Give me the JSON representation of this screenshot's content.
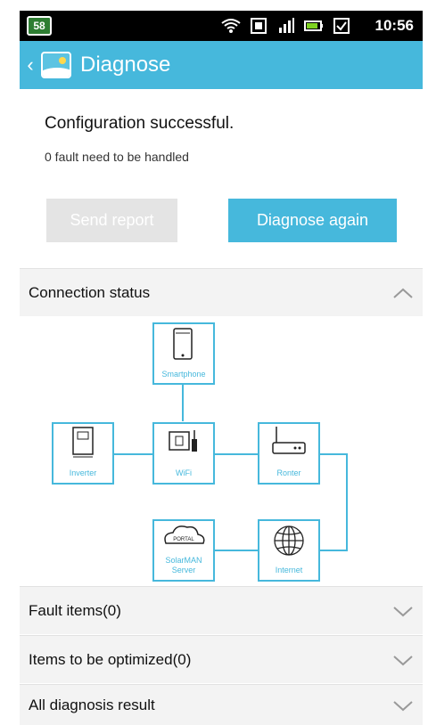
{
  "statusbar": {
    "left_badge": "58",
    "icons": [
      "wifi-icon",
      "data-icon",
      "signal-icon",
      "battery-icon",
      "checkbox-icon"
    ],
    "time": "10:56"
  },
  "appbar": {
    "title": "Diagnose"
  },
  "result": {
    "title": "Configuration successful.",
    "subtitle": "0 fault need to be handled"
  },
  "actions": {
    "send_report": "Send report",
    "diagnose_again": "Diagnose again"
  },
  "sections": {
    "connection_status": "Connection status",
    "fault_items": "Fault items(0)",
    "items_optimized": "Items to be optimized(0)",
    "all_result": "All diagnosis result"
  },
  "diagram": {
    "smartphone": "Smartphone",
    "inverter": "Inverter",
    "wifi": "WiFi",
    "router": "Ronter",
    "server_portal": "PORTAL",
    "server_line1": "SolarMAN",
    "server_line2": "Server",
    "internet": "Internet",
    "accent": "#46b8dc"
  }
}
